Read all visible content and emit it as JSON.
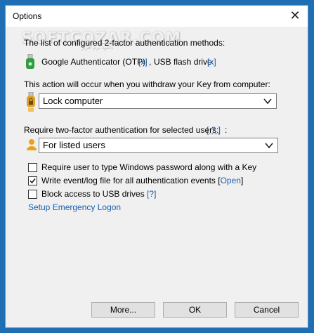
{
  "window": {
    "title": "Options",
    "close_glyph": "✕"
  },
  "watermark": {
    "text": "SOFTCOZAR.COM",
    "sub": "دانلود نرم افزار"
  },
  "methods": {
    "heading": "The list of configured 2-factor authentication methods:",
    "method1": "Google Authenticator (OTP)",
    "remove1": "[x]",
    "separator": ",",
    "method2": "USB flash drive",
    "remove2": "[x]"
  },
  "action": {
    "label": "This action will occur when you withdraw your Key from computer:",
    "selected": "Lock computer"
  },
  "users": {
    "label": "Require two-factor authentication for selected users:",
    "help": "[ ? ]",
    "colon": ":",
    "selected": "For listed users"
  },
  "options": {
    "require_password": "Require user to type Windows password along with a Key",
    "write_log": "Write event/log file for all authentication events [",
    "open_link": "Open",
    "write_log_end": "]",
    "block_usb": "Block access to USB drives",
    "block_help": "[?]",
    "require_password_checked": false,
    "write_log_checked": true,
    "block_usb_checked": false
  },
  "emergency": {
    "link": "Setup Emergency Logon"
  },
  "buttons": {
    "more": "More...",
    "ok": "OK",
    "cancel": "Cancel"
  },
  "colors": {
    "accent": "#1a5fb4",
    "key_green": "#2e9e3e",
    "key_gold": "#e0a020",
    "user_gold": "#e8a317"
  },
  "icons": {
    "method": "usb-key-green-icon",
    "action": "usb-key-lock-icon",
    "users": "user-icon"
  }
}
